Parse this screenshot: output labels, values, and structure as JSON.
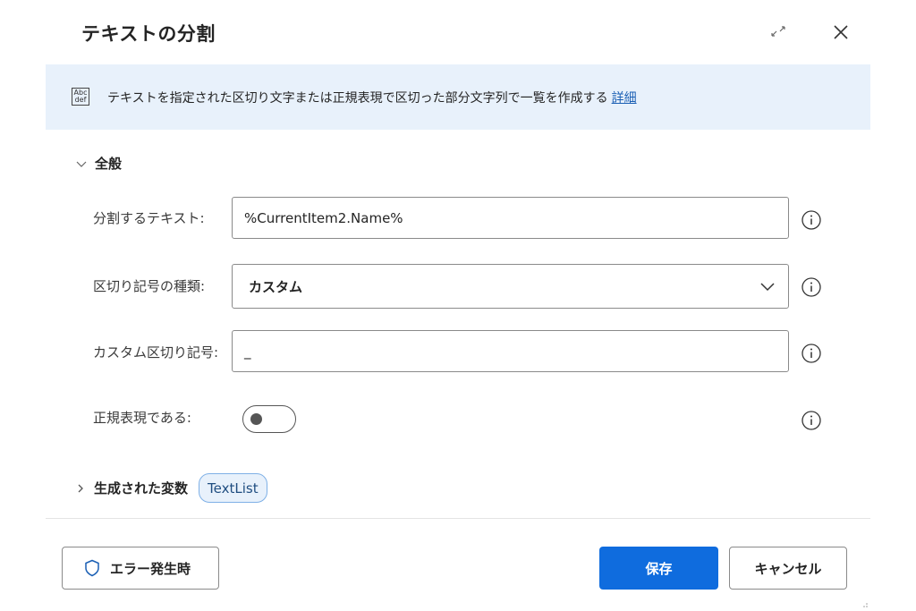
{
  "dialog": {
    "title": "テキストの分割"
  },
  "banner": {
    "icon": "abc-def-icon",
    "icon_text_top": "Abc",
    "icon_text_bottom": "def",
    "description": "テキストを指定された区切り文字または正規表現で区切った部分文字列で一覧を作成する",
    "link_label": "詳細"
  },
  "general_section": {
    "label": "全般",
    "expanded": true
  },
  "fields": {
    "text_to_split": {
      "label": "分割するテキスト:",
      "value": "%CurrentItem2.Name%"
    },
    "delimiter_type": {
      "label": "区切り記号の種類:",
      "selected": "カスタム"
    },
    "custom_delimiter": {
      "label": "カスタム区切り記号:",
      "value": "_"
    },
    "is_regex": {
      "label": "正規表現である:",
      "on": false
    }
  },
  "variables_section": {
    "label": "生成された変数",
    "expanded": false,
    "chip": "TextList"
  },
  "footer": {
    "on_error_label": "エラー発生時",
    "save_label": "保存",
    "cancel_label": "キャンセル"
  },
  "colors": {
    "accent": "#0f6cde",
    "banner_bg": "#e8f1fb",
    "chip_border": "#7fb0e6"
  }
}
